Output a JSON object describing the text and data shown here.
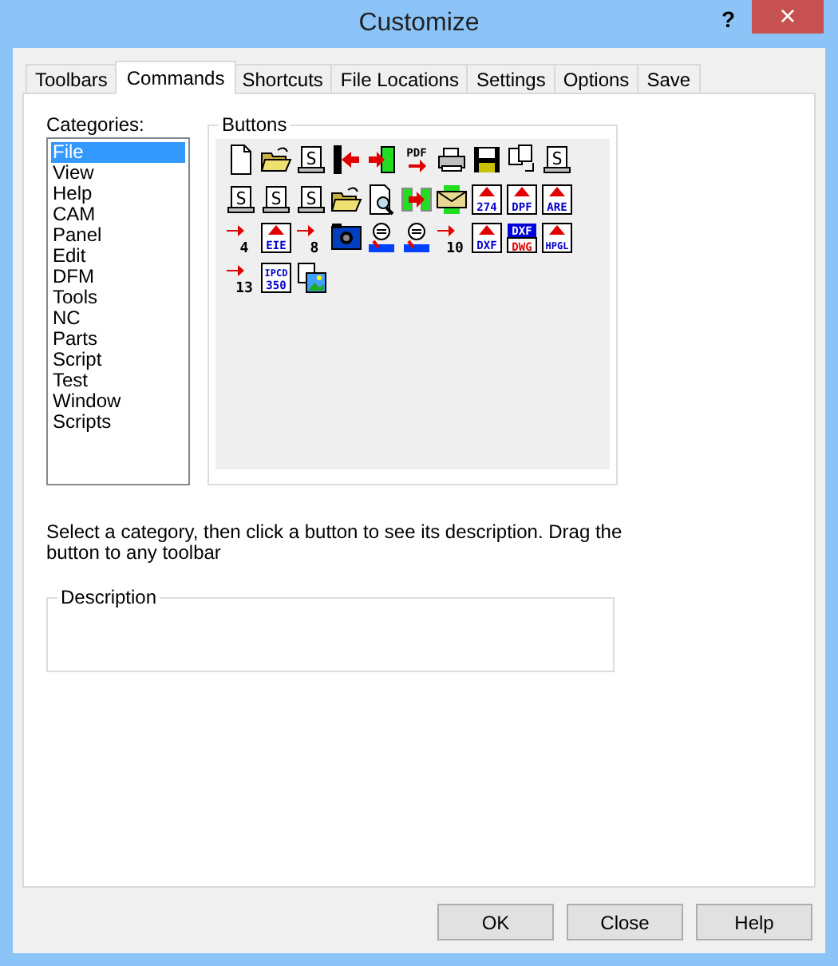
{
  "window": {
    "title": "Customize",
    "help": "?",
    "close": "×"
  },
  "tabs": [
    {
      "label": "Toolbars",
      "selected": false
    },
    {
      "label": "Commands",
      "selected": true
    },
    {
      "label": "Shortcuts",
      "selected": false
    },
    {
      "label": "File Locations",
      "selected": false
    },
    {
      "label": "Settings",
      "selected": false
    },
    {
      "label": "Options",
      "selected": false
    },
    {
      "label": "Save",
      "selected": false
    }
  ],
  "categories": {
    "label": "Categories:",
    "items": [
      {
        "label": "File",
        "selected": true
      },
      {
        "label": "View",
        "selected": false
      },
      {
        "label": "Help",
        "selected": false
      },
      {
        "label": "CAM",
        "selected": false
      },
      {
        "label": "Panel",
        "selected": false
      },
      {
        "label": "Edit",
        "selected": false
      },
      {
        "label": "DFM",
        "selected": false
      },
      {
        "label": "Tools",
        "selected": false
      },
      {
        "label": "NC",
        "selected": false
      },
      {
        "label": "Parts",
        "selected": false
      },
      {
        "label": "Script",
        "selected": false
      },
      {
        "label": "Test",
        "selected": false
      },
      {
        "label": "Window",
        "selected": false
      },
      {
        "label": "Scripts",
        "selected": false
      }
    ]
  },
  "buttons": {
    "label": "Buttons",
    "items": [
      {
        "kind": "page"
      },
      {
        "kind": "folder"
      },
      {
        "kind": "sdoc",
        "text": "S"
      },
      {
        "kind": "exit"
      },
      {
        "kind": "enter"
      },
      {
        "kind": "pdf",
        "text": "PDF"
      },
      {
        "kind": "printer"
      },
      {
        "kind": "floppy"
      },
      {
        "kind": "copy"
      },
      {
        "kind": "sdoc",
        "text": "S"
      },
      {
        "kind": "sdoc",
        "text": "S"
      },
      {
        "kind": "sdoc",
        "text": "S"
      },
      {
        "kind": "sdoc",
        "text": "S"
      },
      {
        "kind": "folder"
      },
      {
        "kind": "preview"
      },
      {
        "kind": "swap"
      },
      {
        "kind": "envelope"
      },
      {
        "kind": "export",
        "text": "274"
      },
      {
        "kind": "export",
        "text": "DPF"
      },
      {
        "kind": "export",
        "text": "ARE"
      },
      {
        "kind": "arrownum",
        "text": "4"
      },
      {
        "kind": "export",
        "text": "EIE"
      },
      {
        "kind": "arrownum",
        "text": "8"
      },
      {
        "kind": "camera"
      },
      {
        "kind": "robot"
      },
      {
        "kind": "robot"
      },
      {
        "kind": "arrownum",
        "text": "10"
      },
      {
        "kind": "export",
        "text": "DXF"
      },
      {
        "kind": "dxfdwg",
        "text": "DXF",
        "text2": "DWG"
      },
      {
        "kind": "export",
        "text": "HPGL"
      },
      {
        "kind": "arrownum",
        "text": "13"
      },
      {
        "kind": "ipcd",
        "text": "IPCD",
        "text2": "350"
      },
      {
        "kind": "image"
      }
    ]
  },
  "hint": "Select a category, then click a button to see its description. Drag the button to any toolbar",
  "description": {
    "label": "Description"
  },
  "actions": [
    "OK",
    "Close",
    "Help"
  ]
}
